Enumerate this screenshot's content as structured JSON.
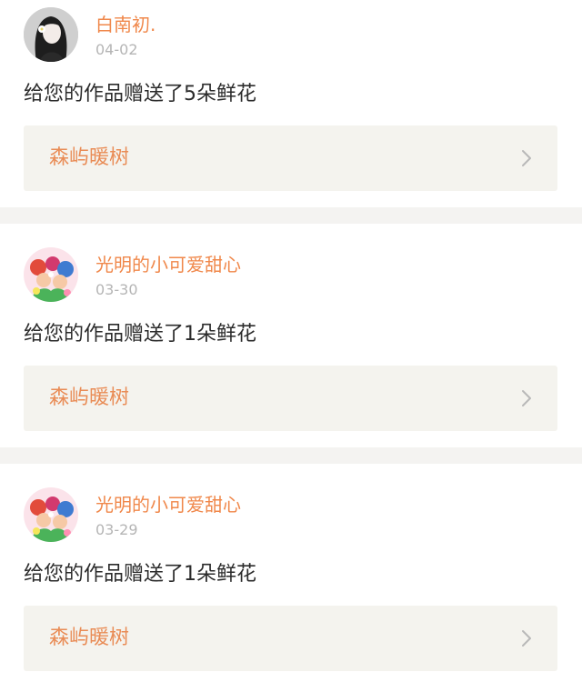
{
  "notifications": [
    {
      "username": "白南初.",
      "date": "04-02",
      "message": "给您的作品赠送了5朵鲜花",
      "work_title": "森屿暖树",
      "avatar": "woman-with-flower-avatar-icon"
    },
    {
      "username": "光明的小可爱甜心",
      "date": "03-30",
      "message": "给您的作品赠送了1朵鲜花",
      "work_title": "森屿暖树",
      "avatar": "anime-group-avatar-icon"
    },
    {
      "username": "光明的小可爱甜心",
      "date": "03-29",
      "message": "给您的作品赠送了1朵鲜花",
      "work_title": "森屿暖树",
      "avatar": "anime-group-avatar-icon"
    }
  ],
  "colors": {
    "accent": "#f0884b",
    "link_text": "#e98c56",
    "link_bg": "#f4f3ee",
    "separator": "#f4f3f1",
    "date_gray": "#b5b5b5",
    "body_text": "#2b2b2b",
    "chevron": "#b8b8b8"
  },
  "icons": {
    "chevron": "chevron-right-icon"
  }
}
